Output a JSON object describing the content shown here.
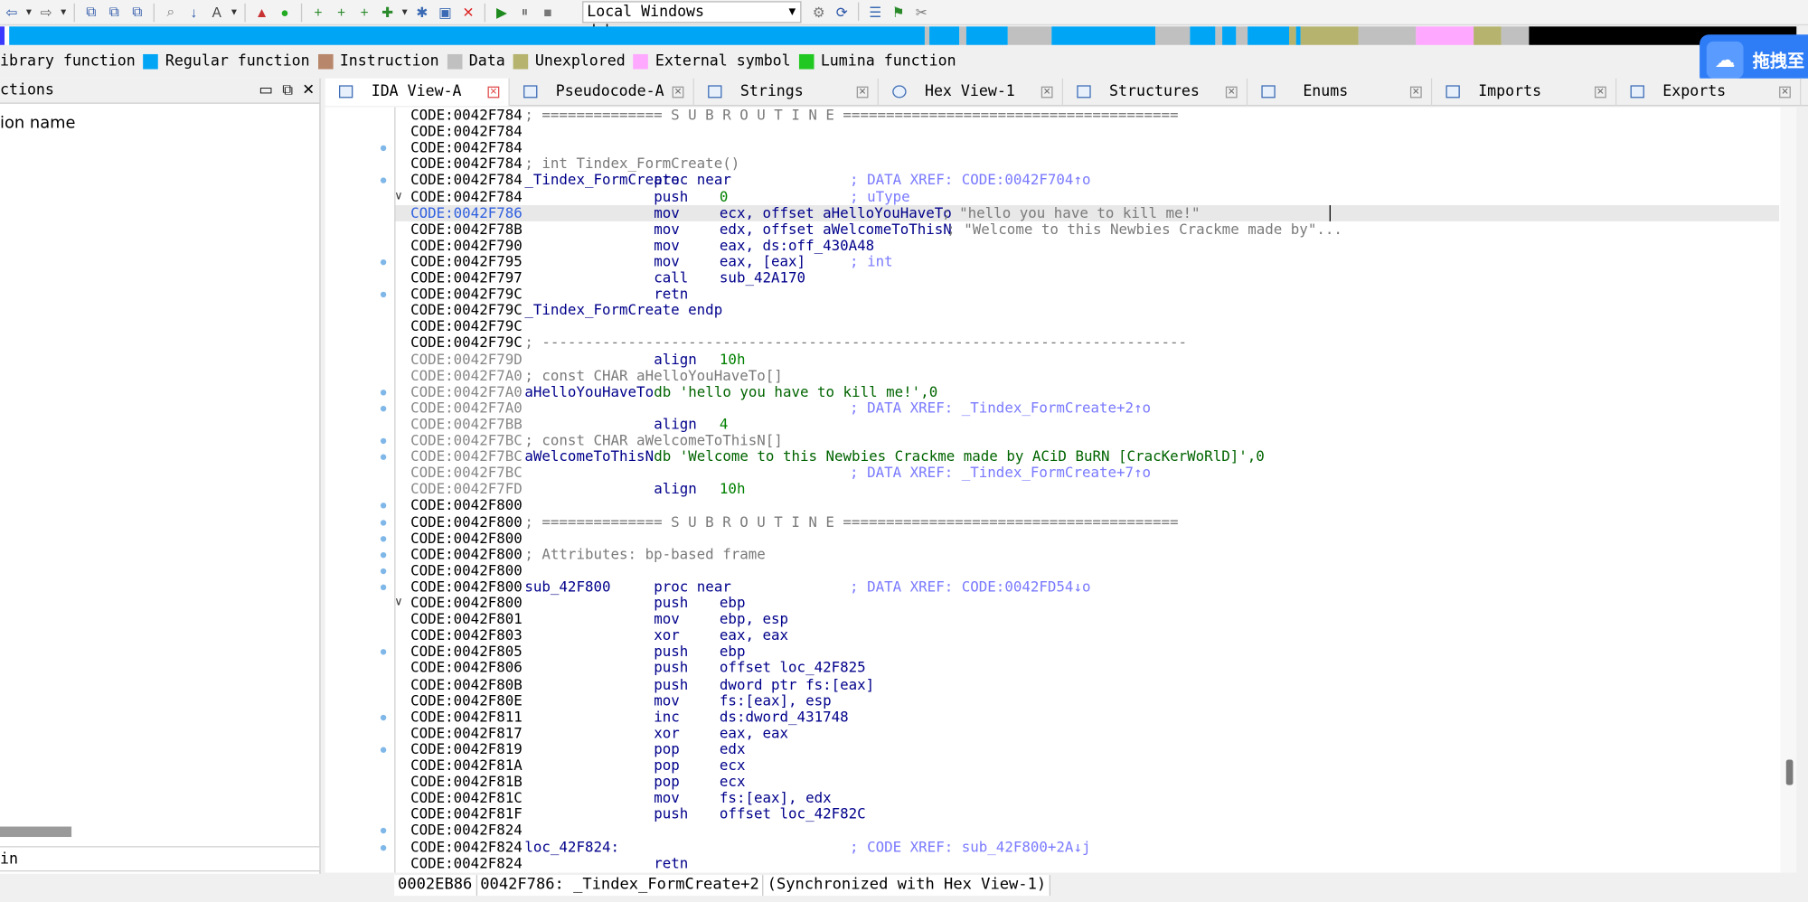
{
  "toolbar": {
    "debugger": "Local Windows debugger"
  },
  "legend": [
    {
      "label": "ibrary function",
      "color": "#74b3e3"
    },
    {
      "label": "Regular function",
      "color": "#00a6f5"
    },
    {
      "label": "Instruction",
      "color": "#b8876b"
    },
    {
      "label": "Data",
      "color": "#c0c0c0"
    },
    {
      "label": "Unexplored",
      "color": "#b5b36e"
    },
    {
      "label": "External symbol",
      "color": "#ffa8ff"
    },
    {
      "label": "Lumina function",
      "color": "#22c822"
    }
  ],
  "baidu": {
    "label": "拖拽至"
  },
  "functions_panel": {
    "title": "ctions",
    "column_header": "ion name",
    "filter_text": "in"
  },
  "tabs": [
    "IDA View-A",
    "Pseudocode-A",
    "Strings",
    "Hex View-1",
    "Structures",
    "Enums",
    "Imports",
    "Exports"
  ],
  "disasm": {
    "lines": [
      {
        "addr": "CODE:0042F784",
        "comment_gray": "; ============== S U B R O U T I N E ======================================="
      },
      {
        "addr": "CODE:0042F784"
      },
      {
        "addr": "CODE:0042F784"
      },
      {
        "addr": "CODE:0042F784",
        "comment_gray": "; int Tindex_FormCreate()"
      },
      {
        "addr": "CODE:0042F784",
        "label": "_Tindex_FormCreate",
        "mnem": "proc near",
        "comment": "; DATA XREF: CODE:0042F704↑o"
      },
      {
        "addr": "CODE:0042F784",
        "mnem": "push",
        "op": "0",
        "comment": "; uType"
      },
      {
        "addr": "CODE:0042F786",
        "mnem": "mov",
        "op": "ecx, offset aHelloYouHaveTo",
        "comment": "; \"hello you have to kill me!\""
      },
      {
        "addr": "CODE:0042F78B",
        "mnem": "mov",
        "op": "edx, offset aWelcomeToThisN",
        "comment": "; \"Welcome to this Newbies Crackme made by\"..."
      },
      {
        "addr": "CODE:0042F790",
        "mnem": "mov",
        "op": "eax, ds:off_430A48"
      },
      {
        "addr": "CODE:0042F795",
        "mnem": "mov",
        "op": "eax, [eax]",
        "comment": "; int"
      },
      {
        "addr": "CODE:0042F797",
        "mnem": "call",
        "op": "sub_42A170"
      },
      {
        "addr": "CODE:0042F79C",
        "mnem": "retn"
      },
      {
        "addr": "CODE:0042F79C",
        "label": "_Tindex_FormCreate endp"
      },
      {
        "addr": "CODE:0042F79C"
      },
      {
        "addr": "CODE:0042F79C",
        "comment_gray": "; ---------------------------------------------------------------------------"
      },
      {
        "addr": "CODE:0042F79D",
        "mnem": "align",
        "op": "10h"
      },
      {
        "addr": "CODE:0042F7A0",
        "comment_gray": "; const CHAR aHelloYouHaveTo[]"
      },
      {
        "addr": "CODE:0042F7A0",
        "label": "aHelloYouHaveTo",
        "data": "db 'hello you have to kill me!',0"
      },
      {
        "addr": "CODE:0042F7A0",
        "comment": "; DATA XREF: _Tindex_FormCreate+2↑o"
      },
      {
        "addr": "CODE:0042F7BB",
        "mnem": "align",
        "op": "4"
      },
      {
        "addr": "CODE:0042F7BC",
        "comment_gray": "; const CHAR aWelcomeToThisN[]"
      },
      {
        "addr": "CODE:0042F7BC",
        "label": "aWelcomeToThisN",
        "data": "db 'Welcome to this Newbies Crackme made by ACiD BuRN [CracKerWoRlD]',0"
      },
      {
        "addr": "CODE:0042F7BC",
        "comment": "; DATA XREF: _Tindex_FormCreate+7↑o"
      },
      {
        "addr": "CODE:0042F7FD",
        "mnem": "align",
        "op": "10h"
      },
      {
        "addr": "CODE:0042F800"
      },
      {
        "addr": "CODE:0042F800",
        "comment_gray": "; ============== S U B R O U T I N E ======================================="
      },
      {
        "addr": "CODE:0042F800"
      },
      {
        "addr": "CODE:0042F800",
        "comment_gray": "; Attributes: bp-based frame"
      },
      {
        "addr": "CODE:0042F800"
      },
      {
        "addr": "CODE:0042F800",
        "label": "sub_42F800",
        "mnem": "proc near",
        "comment": "; DATA XREF: CODE:0042FD54↓o"
      },
      {
        "addr": "CODE:0042F800",
        "mnem": "push",
        "op": "ebp"
      },
      {
        "addr": "CODE:0042F801",
        "mnem": "mov",
        "op": "ebp, esp"
      },
      {
        "addr": "CODE:0042F803",
        "mnem": "xor",
        "op": "eax, eax"
      },
      {
        "addr": "CODE:0042F805",
        "mnem": "push",
        "op": "ebp"
      },
      {
        "addr": "CODE:0042F806",
        "mnem": "push",
        "op": "offset loc_42F825"
      },
      {
        "addr": "CODE:0042F80B",
        "mnem": "push",
        "op": "dword ptr fs:[eax]"
      },
      {
        "addr": "CODE:0042F80E",
        "mnem": "mov",
        "op": "fs:[eax], esp"
      },
      {
        "addr": "CODE:0042F811",
        "mnem": "inc",
        "op": "ds:dword_431748"
      },
      {
        "addr": "CODE:0042F817",
        "mnem": "xor",
        "op": "eax, eax"
      },
      {
        "addr": "CODE:0042F819",
        "mnem": "pop",
        "op": "edx"
      },
      {
        "addr": "CODE:0042F81A",
        "mnem": "pop",
        "op": "ecx"
      },
      {
        "addr": "CODE:0042F81B",
        "mnem": "pop",
        "op": "ecx"
      },
      {
        "addr": "CODE:0042F81C",
        "mnem": "mov",
        "op": "fs:[eax], edx"
      },
      {
        "addr": "CODE:0042F81F",
        "mnem": "push",
        "op": "offset loc_42F82C"
      },
      {
        "addr": "CODE:0042F824"
      },
      {
        "addr": "CODE:0042F824",
        "label": "loc_42F824:",
        "comment": "; CODE XREF: sub_42F800+2A↓j"
      },
      {
        "addr": "CODE:0042F824",
        "mnem": "retn"
      }
    ]
  },
  "status": {
    "offset": "0002EB86",
    "location": "0042F786: _Tindex_FormCreate+2",
    "sync": "(Synchronized with Hex View-1)"
  }
}
